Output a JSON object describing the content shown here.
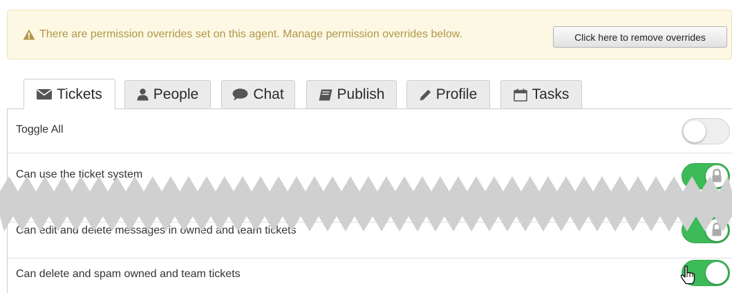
{
  "notice": {
    "icon": "warning-icon",
    "text": "There are permission overrides set on this agent. Manage permission overrides below.",
    "remove_button": "Click here to remove overrides",
    "colors": {
      "background": "#fcf8e4",
      "text": "#b39649"
    }
  },
  "tabs": [
    {
      "label": "Tickets",
      "icon": "envelope-icon",
      "active": true
    },
    {
      "label": "People",
      "icon": "person-icon",
      "active": false
    },
    {
      "label": "Chat",
      "icon": "chat-bubble-icon",
      "active": false
    },
    {
      "label": "Publish",
      "icon": "book-icon",
      "active": false
    },
    {
      "label": "Profile",
      "icon": "pencil-icon",
      "active": false
    },
    {
      "label": "Tasks",
      "icon": "calendar-icon",
      "active": false
    }
  ],
  "permissions": [
    {
      "label": "Toggle All",
      "enabled": false
    },
    {
      "label": "Can use the ticket system",
      "enabled": true,
      "locked": true
    },
    {
      "label": "Can edit and delete messages in owned and team tickets",
      "enabled": true,
      "locked": true
    },
    {
      "label": "Can delete and spam owned and team tickets",
      "enabled": true
    }
  ],
  "colors": {
    "toggle_on": "#3dbb59",
    "toggle_off": "#eeeeee"
  }
}
